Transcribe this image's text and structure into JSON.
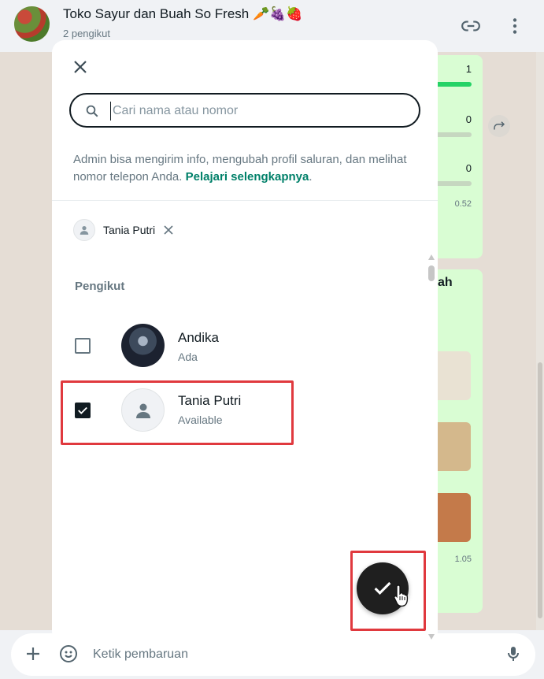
{
  "header": {
    "title": "Toko Sayur dan Buah So Fresh",
    "title_emoji": "🥕🍇🍓",
    "subtitle": "2 pengikut"
  },
  "background": {
    "counts": [
      "1",
      "0",
      "0"
    ],
    "times": [
      "0.52",
      "1.05"
    ],
    "title_fragment": "ah"
  },
  "composer": {
    "placeholder": "Ketik pembaruan"
  },
  "modal": {
    "search_placeholder": "Cari nama atau nomor",
    "search_value": "",
    "info_text": "Admin bisa mengirim info, mengubah profil saluran, dan melihat nomor telepon Anda.",
    "info_link": "Pelajari selengkapnya",
    "info_end": ".",
    "selected_chip": "Tania Putri",
    "section_title": "Pengikut",
    "contacts": [
      {
        "name": "Andika",
        "status": "Ada",
        "checked": false
      },
      {
        "name": "Tania Putri",
        "status": "Available",
        "checked": true
      }
    ]
  },
  "colors": {
    "accent": "#008069",
    "highlight": "#e0393e",
    "confirm": "#1f1f1f"
  },
  "icons": [
    "link-icon",
    "more-vertical-icon",
    "close-icon",
    "search-icon",
    "person-icon",
    "check-icon",
    "plus-icon",
    "sticker-icon",
    "mic-icon",
    "forward-icon"
  ]
}
